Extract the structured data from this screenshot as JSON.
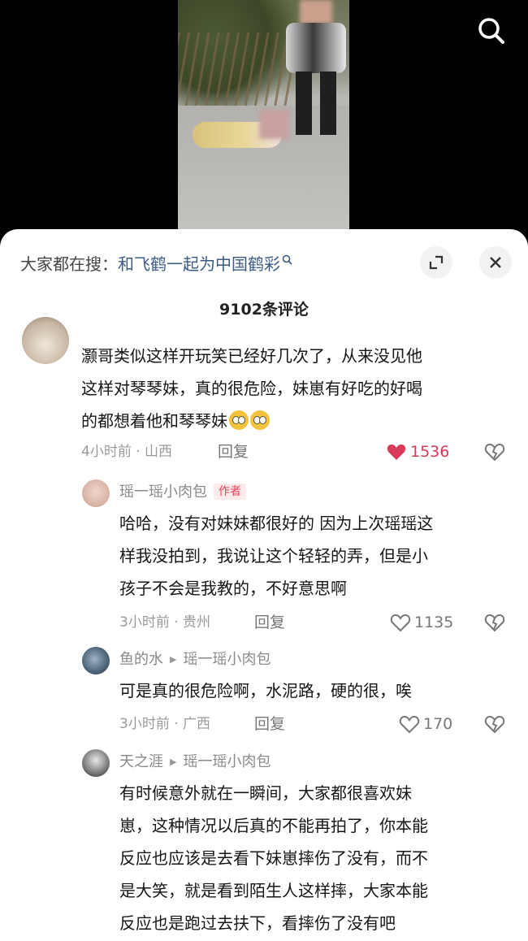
{
  "colors": {
    "accent_like": "#d93a59",
    "topic_link": "#3b5b86",
    "author_badge": "#e8425b",
    "muted": "#9a9a9a"
  },
  "video": {
    "search_icon": "search-icon"
  },
  "header": {
    "trend_prefix": "大家都在搜：",
    "trend_topic": "和飞鹤一起为中国鹤彩",
    "expand_icon": "expand-icon",
    "close_icon": "close-icon"
  },
  "comment_count": "9102条评论",
  "comments": [
    {
      "text_lines": [
        "灏哥类似这样开玩笑已经好几次了，从来没见他",
        "这样对琴琴妹，真的很危险，妹崽有好吃的好喝",
        "的都想着他和琴琴妹"
      ],
      "emoji": "pleading-face-emoji",
      "meta": "4小时前 · 山西",
      "reply": "回复",
      "likes": "1536",
      "liked": true
    },
    {
      "username": "瑶一瑶小肉包",
      "badge": "作者",
      "text_lines": [
        "哈哈，没有对妹妹都很好的 因为上次瑶瑶这",
        "样我没拍到，我说让这个轻轻的弄，但是小",
        "孩子不会是我教的，不好意思啊"
      ],
      "meta": "3小时前 · 贵州",
      "reply": "回复",
      "likes": "1135",
      "liked": false
    },
    {
      "username": "鱼的水",
      "reply_to": "瑶一瑶小肉包",
      "text_lines": [
        "可是真的很危险啊，水泥路，硬的很，唉"
      ],
      "meta": "3小时前 · 广西",
      "reply": "回复",
      "likes": "170",
      "liked": false
    },
    {
      "username": "天之涯",
      "reply_to": "瑶一瑶小肉包",
      "text_lines": [
        "有时候意外就在一瞬间，大家都很喜欢妹",
        "崽，这种情况以后真的不能再拍了，你本能",
        "反应也应该是去看下妹崽摔伤了没有，而不",
        "是大笑，就是看到陌生人这样摔，大家本能",
        "反应也是跑过去扶下，看摔伤了没有吧"
      ]
    }
  ]
}
